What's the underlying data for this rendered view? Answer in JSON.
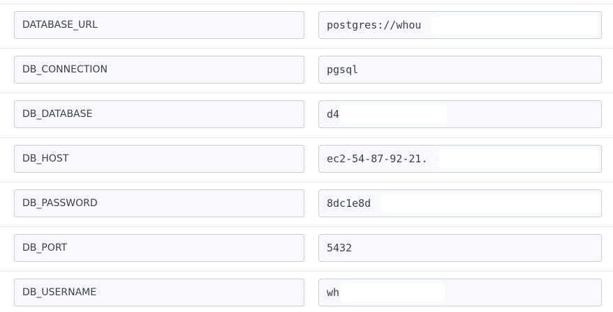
{
  "env_vars": [
    {
      "key": "DATABASE_URL",
      "value": "postgres://whou"
    },
    {
      "key": "DB_CONNECTION",
      "value": "pgsql"
    },
    {
      "key": "DB_DATABASE",
      "value": "d4"
    },
    {
      "key": "DB_HOST",
      "value": "ec2-54-87-92-21."
    },
    {
      "key": "DB_PASSWORD",
      "value": "8dc1e8d"
    },
    {
      "key": "DB_PORT",
      "value": "5432"
    },
    {
      "key": "DB_USERNAME",
      "value": "wh"
    }
  ],
  "colors": {
    "field_background": "#f7f9fc",
    "field_border": "#c9d0da",
    "divider": "#e6e9ee",
    "text": "#3a3f47"
  }
}
